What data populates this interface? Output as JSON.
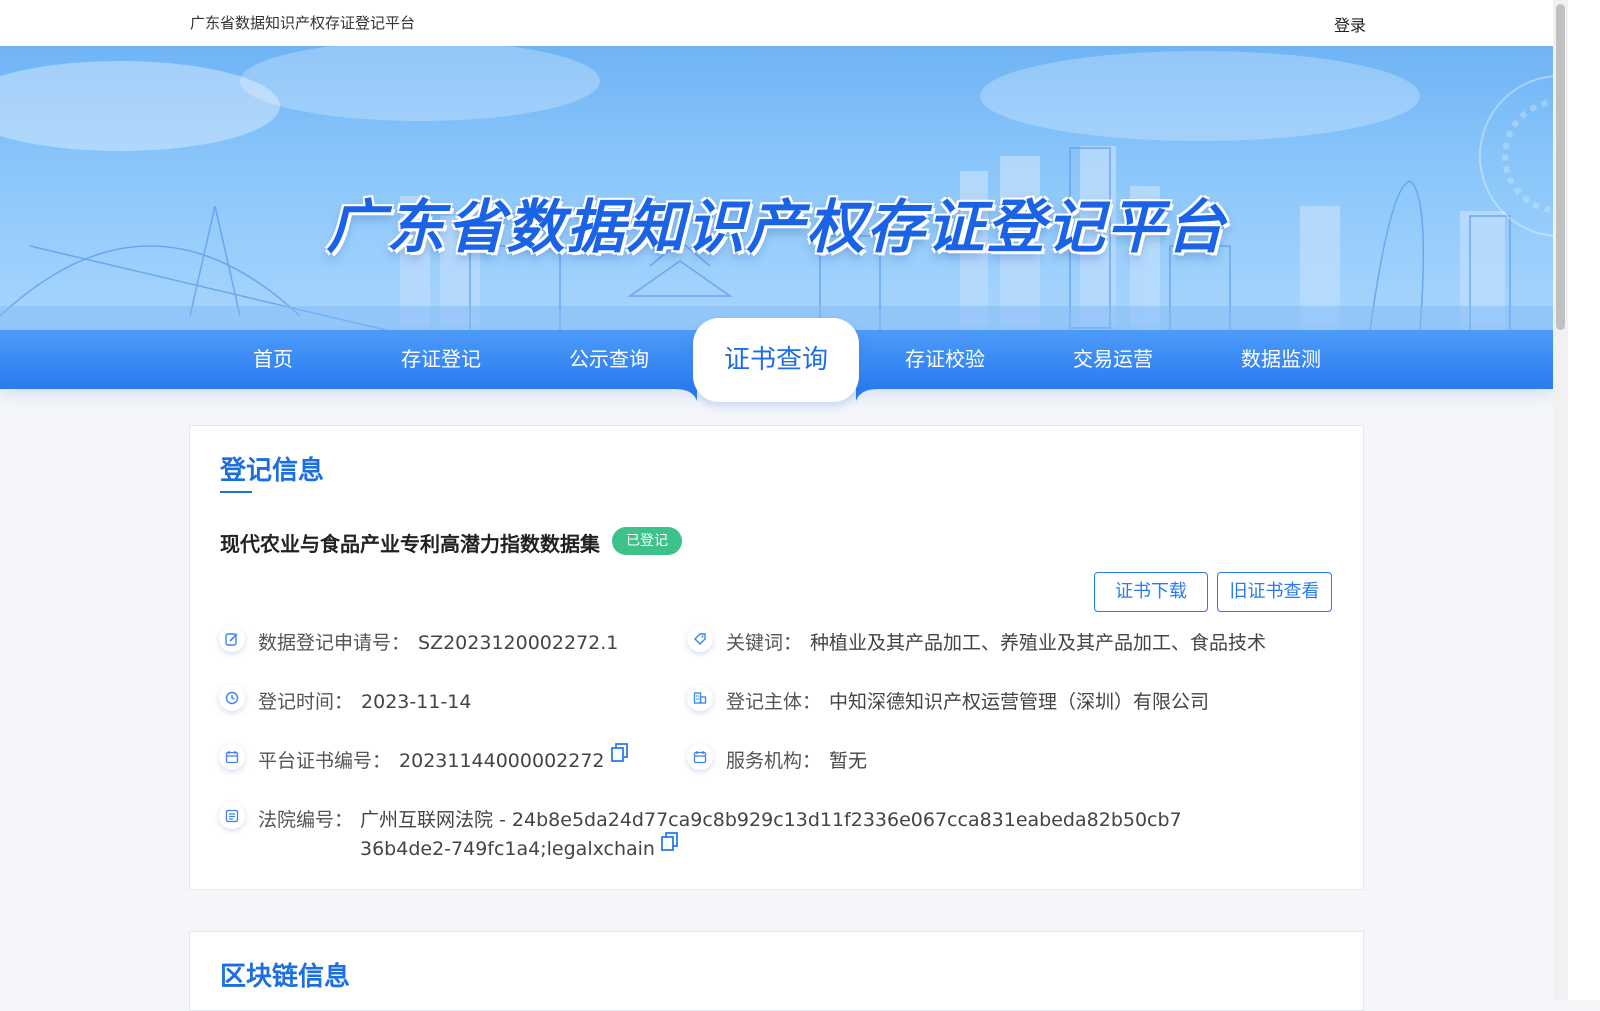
{
  "header": {
    "site_name": "广东省数据知识产权存证登记平台",
    "login_label": "登录"
  },
  "banner": {
    "title": "广东省数据知识产权存证登记平台"
  },
  "nav": {
    "items": [
      {
        "label": "首页"
      },
      {
        "label": "存证登记"
      },
      {
        "label": "公示查询"
      },
      {
        "label": "证书查询",
        "active": true
      },
      {
        "label": "存证校验"
      },
      {
        "label": "交易运营"
      },
      {
        "label": "数据监测"
      }
    ]
  },
  "registration": {
    "section_title": "登记信息",
    "dataset_name": "现代农业与食品产业专利高潜力指数数据集",
    "status_badge": "已登记",
    "download_button": "证书下载",
    "old_cert_button": "旧证书查看",
    "fields": {
      "application_no_label": "数据登记申请号：",
      "application_no": "SZ2023120002272.1",
      "keywords_label": "关键词：",
      "keywords": "种植业及其产品加工、养殖业及其产品加工、食品技术",
      "reg_time_label": "登记时间：",
      "reg_time": "2023-11-14",
      "subject_label": "登记主体：",
      "subject": "中知深德知识产权运营管理（深圳）有限公司",
      "cert_no_label": "平台证书编号：",
      "cert_no": "20231144000002272",
      "agency_label": "服务机构：",
      "agency": "暂无",
      "court_no_label": "法院编号：",
      "court_no": "广州互联网法院 - 24b8e5da24d77ca9c8b929c13d11f2336e067cca831eabeda82b50cb736b4de2-749fc1a4;legalxchain"
    }
  },
  "blockchain": {
    "section_title": "区块链信息"
  },
  "colors": {
    "brand_blue": "#1b6fe0",
    "nav_blue": "#2a7bf0",
    "badge_green": "#3cc28a"
  }
}
